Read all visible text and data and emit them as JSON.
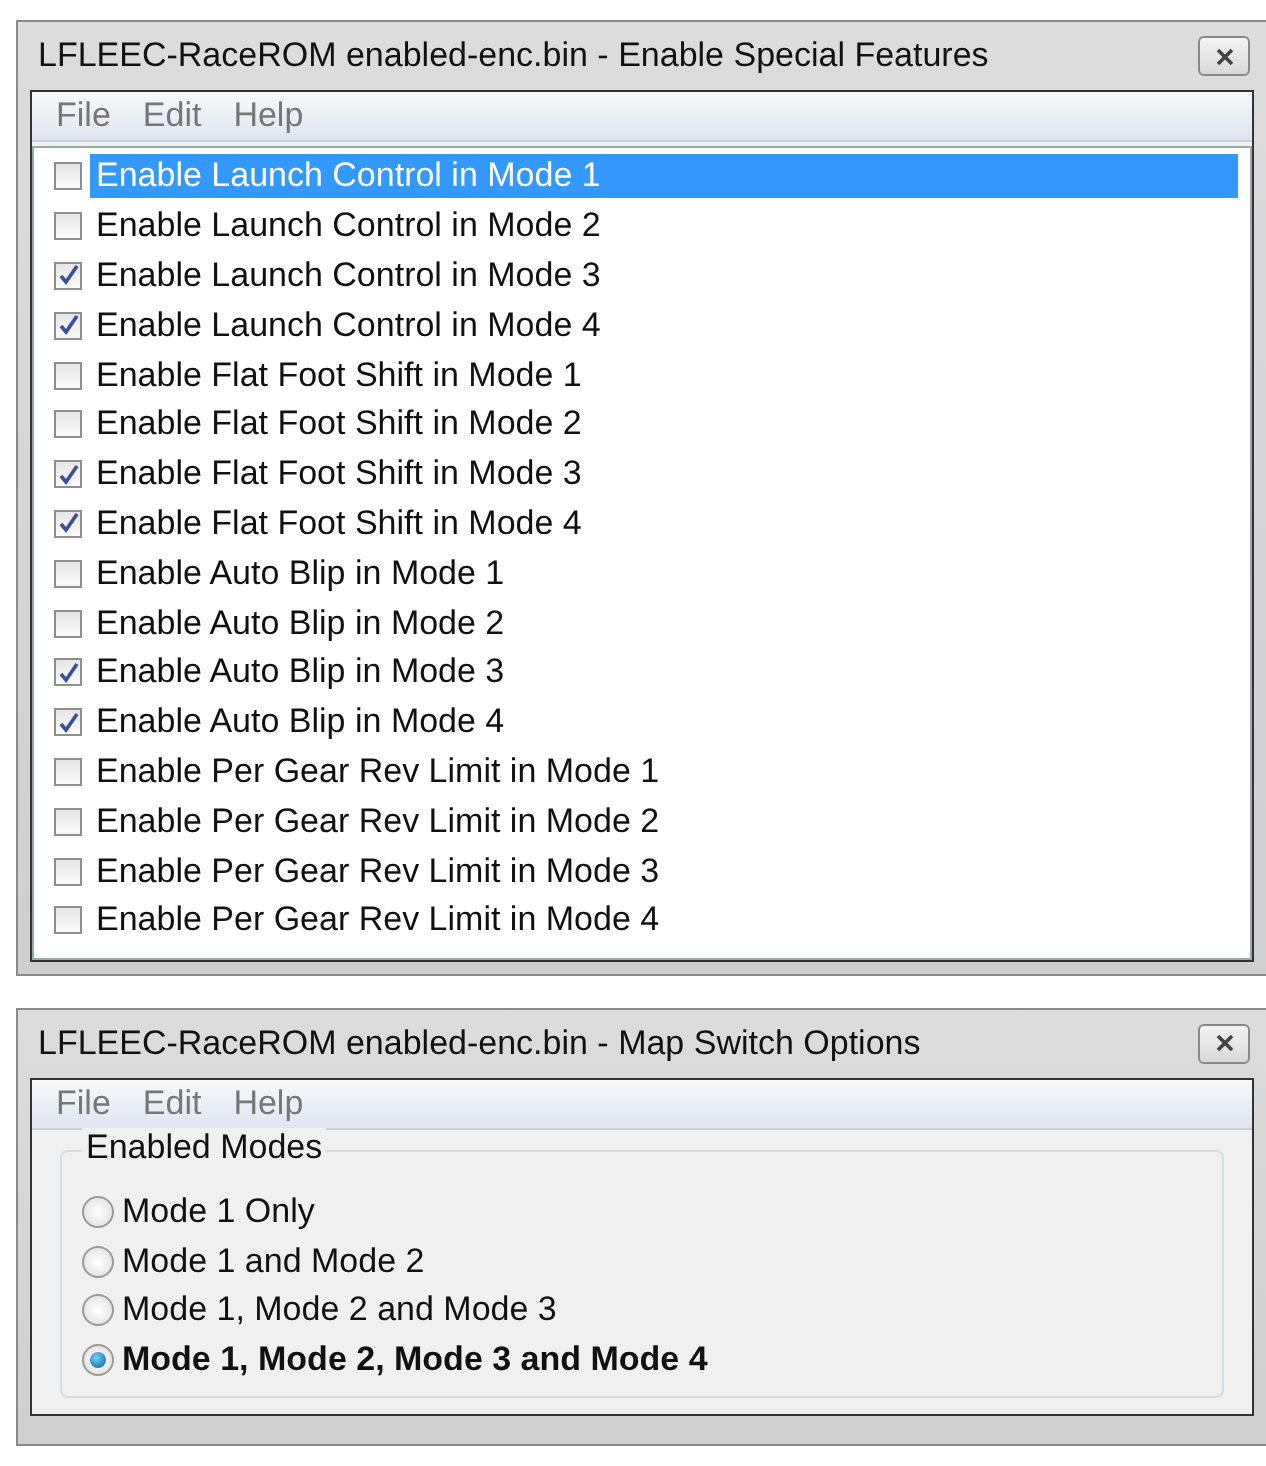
{
  "windows": [
    {
      "title": "LFLEEC-RaceROM enabled-enc.bin - Enable Special Features",
      "menu": [
        "File",
        "Edit",
        "Help"
      ],
      "kind": "checklist",
      "items": [
        {
          "label": "Enable Launch Control in Mode 1",
          "checked": false,
          "selected": true
        },
        {
          "label": "Enable Launch Control in Mode 2",
          "checked": false,
          "selected": false
        },
        {
          "label": "Enable Launch Control in Mode 3",
          "checked": true,
          "selected": false
        },
        {
          "label": "Enable Launch Control in Mode 4",
          "checked": true,
          "selected": false
        },
        {
          "label": "Enable Flat Foot Shift in Mode 1",
          "checked": false,
          "selected": false
        },
        {
          "label": "Enable Flat Foot Shift in Mode 2",
          "checked": false,
          "selected": false
        },
        {
          "label": "Enable Flat Foot Shift in Mode 3",
          "checked": true,
          "selected": false
        },
        {
          "label": "Enable Flat Foot Shift in Mode 4",
          "checked": true,
          "selected": false
        },
        {
          "label": "Enable Auto Blip in Mode 1",
          "checked": false,
          "selected": false
        },
        {
          "label": "Enable Auto Blip in Mode 2",
          "checked": false,
          "selected": false
        },
        {
          "label": "Enable Auto Blip in Mode 3",
          "checked": true,
          "selected": false
        },
        {
          "label": "Enable Auto Blip in Mode 4",
          "checked": true,
          "selected": false
        },
        {
          "label": "Enable Per Gear Rev Limit in Mode 1",
          "checked": false,
          "selected": false
        },
        {
          "label": "Enable Per Gear Rev Limit in Mode 2",
          "checked": false,
          "selected": false
        },
        {
          "label": "Enable Per Gear Rev Limit in Mode 3",
          "checked": false,
          "selected": false
        },
        {
          "label": "Enable Per Gear Rev Limit in Mode 4",
          "checked": false,
          "selected": false
        }
      ]
    },
    {
      "title": "LFLEEC-RaceROM enabled-enc.bin - Map Switch Options",
      "menu": [
        "File",
        "Edit",
        "Help"
      ],
      "kind": "radiogroup",
      "group_title": "Enabled Modes",
      "items": [
        {
          "label": "Mode 1 Only",
          "selected": false
        },
        {
          "label": "Mode 1 and Mode 2",
          "selected": false
        },
        {
          "label": "Mode 1, Mode 2 and Mode 3",
          "selected": false
        },
        {
          "label": "Mode 1, Mode 2, Mode 3 and Mode 4",
          "selected": true
        }
      ]
    }
  ]
}
